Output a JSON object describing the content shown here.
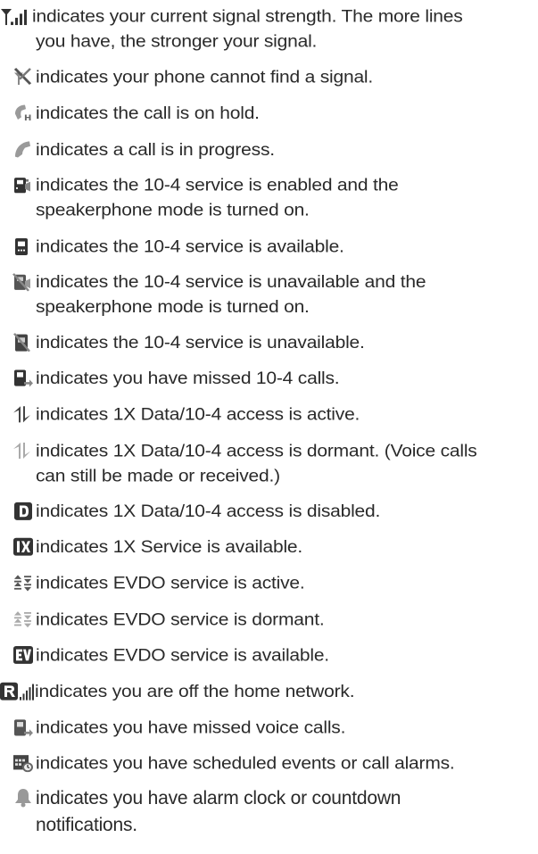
{
  "items": [
    {
      "icon": "signal-strength-icon",
      "line1": "indicates your current signal strength. The more lines",
      "line2": "you have, the stronger your signal."
    },
    {
      "icon": "no-signal-icon",
      "line1": "indicates your phone cannot find a signal."
    },
    {
      "icon": "call-on-hold-icon",
      "line1": "indicates the call is on hold."
    },
    {
      "icon": "call-in-progress-icon",
      "line1": "indicates a call is in progress."
    },
    {
      "icon": "ten-four-speakerphone-icon",
      "line1": "indicates the 10-4 service is enabled and the",
      "line2": "speakerphone mode is turned on."
    },
    {
      "icon": "ten-four-available-icon",
      "line1": "indicates the 10-4 service is available."
    },
    {
      "icon": "ten-four-unavailable-speakerphone-icon",
      "line1": "indicates the 10-4 service is unavailable and the",
      "line2": "speakerphone mode is turned on."
    },
    {
      "icon": "ten-four-unavailable-icon",
      "line1": "indicates the 10-4 service is unavailable."
    },
    {
      "icon": "missed-ten-four-calls-icon",
      "line1": "indicates you have missed 10-4 calls."
    },
    {
      "icon": "data-active-icon",
      "line1": "indicates 1X Data/10-4 access is active."
    },
    {
      "icon": "data-dormant-icon",
      "line1": "indicates 1X Data/10-4 access is dormant. (Voice calls",
      "line2": "can still be made or received.)"
    },
    {
      "icon": "data-disabled-icon",
      "line1": "indicates 1X Data/10-4 access is disabled."
    },
    {
      "icon": "one-x-service-icon",
      "line1": "indicates 1X Service is available."
    },
    {
      "icon": "evdo-active-icon",
      "line1": "indicates EVDO service is active."
    },
    {
      "icon": "evdo-dormant-icon",
      "line1": "indicates EVDO service is dormant."
    },
    {
      "icon": "evdo-available-icon",
      "line1": "indicates EVDO service is available."
    },
    {
      "icon": "roaming-icon",
      "line1": "indicates you are off the home network."
    },
    {
      "icon": "missed-voice-calls-icon",
      "line1": "indicates you have missed voice calls."
    },
    {
      "icon": "scheduled-events-icon",
      "line1": "indicates you have scheduled events or call alarms."
    },
    {
      "icon": "alarm-notification-icon",
      "line1": "indicates you have alarm clock or countdown",
      "line2": "notifications."
    }
  ],
  "colors": {
    "text": "#2a2a2a",
    "icon_dark": "#333333",
    "icon_gray": "#9a9a9a"
  }
}
